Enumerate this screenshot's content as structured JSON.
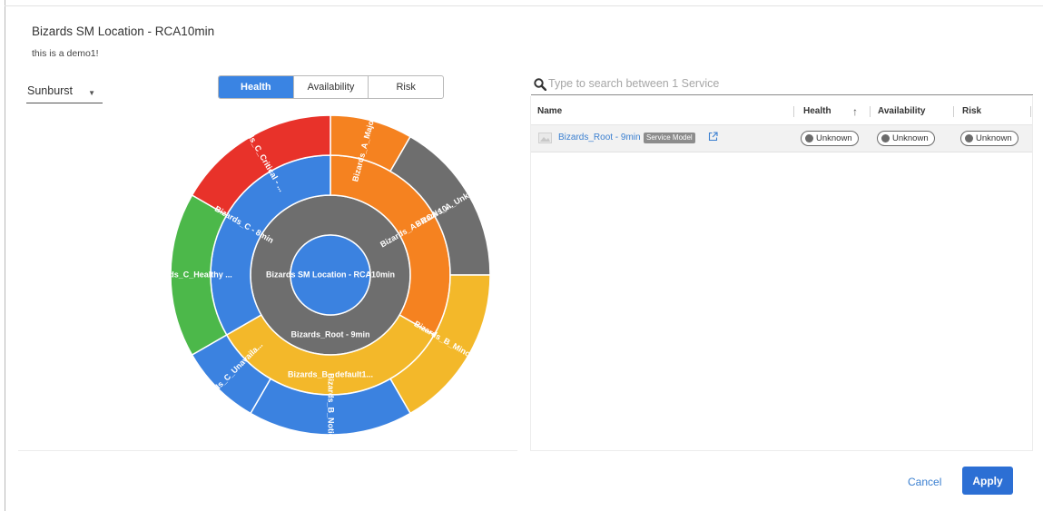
{
  "header": {
    "title": "Bizards SM Location - RCA10min",
    "subtitle": "this is a demo1!"
  },
  "view_select": {
    "value": "Sunburst",
    "icon": "caret-down-icon"
  },
  "tabs": [
    {
      "label": "Health",
      "active": true
    },
    {
      "label": "Availability",
      "active": false
    },
    {
      "label": "Risk",
      "active": false
    }
  ],
  "sunburst": {
    "colors": {
      "blue": "#3b82e0",
      "gray": "#6e6e6e",
      "orange": "#f58220",
      "yellow": "#f3b82a",
      "red": "#e8322a",
      "green": "#4cb84a"
    },
    "center": {
      "label": "Bizards SM Location - RCA10min",
      "color": "blue"
    },
    "ring1": {
      "label": "Bizards_Root - 9min",
      "color": "gray"
    },
    "ring2": [
      {
        "label": "Bizards_A - RCA 10...",
        "color": "orange"
      },
      {
        "label": "Bizards_B - default1...",
        "color": "yellow"
      },
      {
        "label": "Bizards_C - 8min",
        "color": "blue"
      }
    ],
    "ring3": [
      {
        "label": "Bizards_A_Major - R...",
        "color": "orange"
      },
      {
        "label": "Bizards_A_Unknown",
        "color": "gray"
      },
      {
        "label": "Bizards_B_Minor - 2...",
        "color": "yellow"
      },
      {
        "label": "Bizards_B_Notice - ...",
        "color": "blue"
      },
      {
        "label": "Bizards_C_Unavaila...",
        "color": "blue"
      },
      {
        "label": "Bizards_C_Healthy ...",
        "color": "green"
      },
      {
        "label": "Bizards_C_Critical - ...",
        "color": "red"
      }
    ]
  },
  "search": {
    "placeholder": "Type to search between 1 Service",
    "value": "",
    "icon": "search-icon"
  },
  "table": {
    "columns": [
      "Name",
      "Health",
      "Availability",
      "Risk"
    ],
    "sort": {
      "column": "Health",
      "direction": "asc",
      "icon": "arrow-up-icon"
    },
    "rows": [
      {
        "name": "Bizards_Root - 9min",
        "badge": "Service Model",
        "health": "Unknown",
        "availability": "Unknown",
        "risk": "Unknown"
      }
    ]
  },
  "footer": {
    "cancel_label": "Cancel",
    "apply_label": "Apply"
  }
}
